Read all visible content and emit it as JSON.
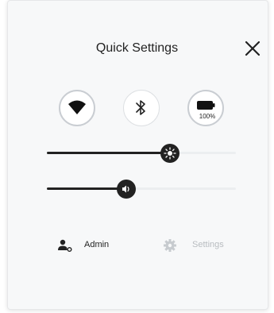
{
  "header": {
    "title": "Quick Settings"
  },
  "toggles": {
    "wifi": {
      "icon": "wifi-icon",
      "enabled": true
    },
    "bluetooth": {
      "icon": "bluetooth-icon",
      "enabled": false
    },
    "battery": {
      "icon": "battery-icon",
      "label": "100%"
    }
  },
  "sliders": {
    "brightness": {
      "icon": "brightness-icon",
      "level": 0.65
    },
    "volume": {
      "icon": "volume-icon",
      "level": 0.42
    }
  },
  "footer": {
    "user_label": "Admin",
    "settings_label": "Settings"
  },
  "colors": {
    "panel": "#f7f8f9",
    "text": "#222222",
    "disabled_text": "#b8bcc0",
    "track": "#eceef0",
    "fill": "#222222"
  }
}
